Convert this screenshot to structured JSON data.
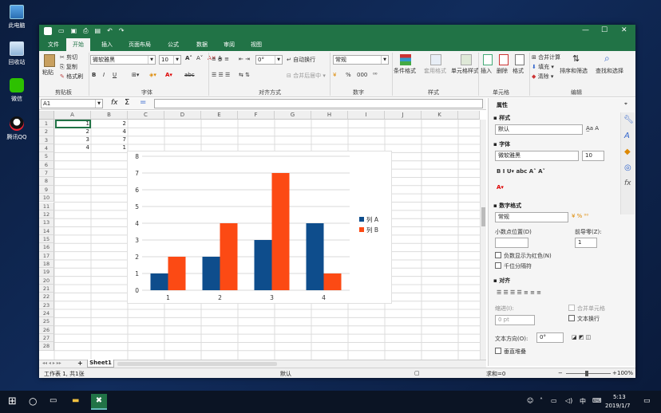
{
  "desktop": {
    "icons": [
      {
        "label": "此电脑",
        "icon": "computer-icon"
      },
      {
        "label": "回收站",
        "icon": "recycle-bin-icon"
      },
      {
        "label": "微信",
        "icon": "wechat-icon"
      },
      {
        "label": "腾讯QQ",
        "icon": "qq-icon"
      }
    ]
  },
  "window": {
    "controls": {
      "minimize": "—",
      "maximize": "☐",
      "close": "✕"
    },
    "quick_access": {
      "undo": "↶",
      "redo": "↷"
    }
  },
  "tabs": [
    {
      "label": "文件",
      "active": false
    },
    {
      "label": "开始",
      "active": true
    },
    {
      "label": "插入",
      "active": false
    },
    {
      "label": "页面布局",
      "active": false
    },
    {
      "label": "公式",
      "active": false
    },
    {
      "label": "数据",
      "active": false
    },
    {
      "label": "审阅",
      "active": false
    },
    {
      "label": "视图",
      "active": false
    }
  ],
  "ribbon": {
    "clipboard": {
      "paste": "粘贴",
      "cut": "剪切",
      "copy": "复制",
      "format_painter": "格式刷",
      "group": "剪贴板"
    },
    "font": {
      "family": "微软雅黑",
      "size": "10",
      "bold": "B",
      "italic": "I",
      "underline": "U",
      "strike": "abc",
      "group": "字体"
    },
    "alignment": {
      "wrap": "自动换行",
      "merge": "合并后居中",
      "angle": "0°",
      "group": "对齐方式"
    },
    "number": {
      "format": "常规",
      "percent": "%",
      "comma": "000",
      "group": "数字"
    },
    "styles": {
      "conditional": "条件格式",
      "table_style": "套用格式",
      "cell_style": "单元格样式",
      "group": "样式"
    },
    "cells": {
      "insert": "插入",
      "delete": "删除",
      "format": "格式",
      "group": "单元格"
    },
    "editing": {
      "merge_calc": "合并计算",
      "fill": "填充",
      "clear": "清除",
      "sort_filter": "排序和筛选",
      "find_select": "查找和选择",
      "group": "编辑"
    }
  },
  "formula_bar": {
    "name_box": "A1",
    "fx": "fx",
    "sigma": "Σ",
    "equals": "=",
    "value": ""
  },
  "sheet": {
    "columns": [
      "A",
      "B",
      "C",
      "D",
      "E",
      "F",
      "G",
      "H",
      "I",
      "J",
      "K"
    ],
    "rows": [
      "1",
      "2",
      "3",
      "4",
      "5",
      "6",
      "7",
      "8",
      "9",
      "10",
      "11",
      "12",
      "13",
      "14",
      "15",
      "16",
      "17",
      "18",
      "19",
      "20",
      "21",
      "22",
      "23",
      "24",
      "25",
      "26",
      "27",
      "28"
    ],
    "cells": [
      {
        "a": "1",
        "b": "2"
      },
      {
        "a": "2",
        "b": "4"
      },
      {
        "a": "3",
        "b": "7"
      },
      {
        "a": "4",
        "b": "1"
      }
    ]
  },
  "chart_data": {
    "type": "bar",
    "categories": [
      "1",
      "2",
      "3",
      "4"
    ],
    "series": [
      {
        "name": "列 A",
        "values": [
          1,
          2,
          3,
          4
        ],
        "color": "#0e4d8c"
      },
      {
        "name": "列 B",
        "values": [
          2,
          4,
          7,
          1
        ],
        "color": "#fc4a14"
      }
    ],
    "yticks": [
      "0",
      "1",
      "2",
      "3",
      "4",
      "5",
      "6",
      "7",
      "8"
    ],
    "ylim": [
      0,
      8
    ],
    "grid": true,
    "legend": "right"
  },
  "sheet_tabs": {
    "active": "Sheet1",
    "add": "+"
  },
  "panel": {
    "title": "属性",
    "style": {
      "head": "样式",
      "value": "默认"
    },
    "font": {
      "head": "字体",
      "family": "微软雅黑",
      "size": "10"
    },
    "number_format": {
      "head": "数字格式",
      "value": "常规",
      "decimals_label": "小数点位置(D)",
      "leading_zero_label": "前导零(Z):",
      "leading_zero_value": "1",
      "negative_red": "负数显示为红色(N)",
      "thousands": "千位分隔符"
    },
    "alignment": {
      "head": "对齐",
      "indent_label": "缩进(I):",
      "indent_value": "0 pt",
      "merge": "合并单元格",
      "wrap": "文本换行",
      "direction_label": "文本方向(O):",
      "direction_value": "0°",
      "vertical_stack": "垂直堆叠"
    }
  },
  "status": {
    "left": "工作表 1, 共1张",
    "style": "默认",
    "sum": "求和=0",
    "zoom": "100%"
  },
  "taskbar": {
    "time": "5:13",
    "date": "2019/1/7",
    "ime": "中"
  }
}
